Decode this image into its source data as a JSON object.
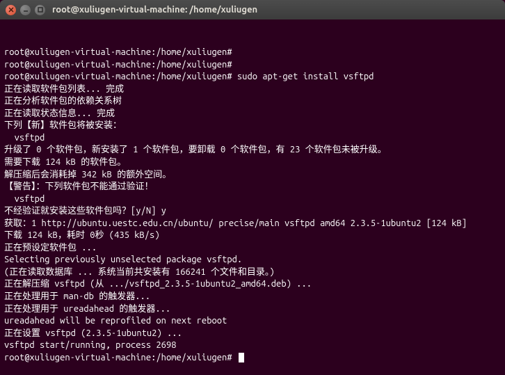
{
  "window": {
    "title": "root@xuliugen-virtual-machine: /home/xuliugen"
  },
  "terminal": {
    "lines": [
      "root@xuliugen-virtual-machine:/home/xuliugen#",
      "root@xuliugen-virtual-machine:/home/xuliugen#",
      "root@xuliugen-virtual-machine:/home/xuliugen# sudo apt-get install vsftpd",
      "正在读取软件包列表... 完成",
      "正在分析软件包的依赖关系树       ",
      "正在读取状态信息... 完成       ",
      "下列【新】软件包将被安装：",
      "  vsftpd",
      "升级了 0 个软件包，新安装了 1 个软件包，要卸载 0 个软件包，有 23 个软件包未被升级。",
      "需要下载 124 kB 的软件包。",
      "解压缩后会消耗掉 342 kB 的额外空间。",
      "【警告】：下列软件包不能通过验证！",
      "  vsftpd",
      "不经验证就安装这些软件包吗？[y/N] y",
      "获取：1 http://ubuntu.uestc.edu.cn/ubuntu/ precise/main vsftpd amd64 2.3.5-1ubuntu2 [124 kB]",
      "下载 124 kB，耗时 0秒 (435 kB/s)",
      "正在预设定软件包 ...",
      "Selecting previously unselected package vsftpd.",
      "(正在读取数据库 ... 系统当前共安装有 166241 个文件和目录。)",
      "正在解压缩 vsftpd (从 .../vsftpd_2.3.5-1ubuntu2_amd64.deb) ...",
      "正在处理用于 man-db 的触发器...",
      "正在处理用于 ureadahead 的触发器...",
      "ureadahead will be reprofiled on next reboot",
      "正在设置 vsftpd (2.3.5-1ubuntu2) ...",
      "vsftpd start/running, process 2698"
    ],
    "prompt_final": "root@xuliugen-virtual-machine:/home/xuliugen# "
  }
}
